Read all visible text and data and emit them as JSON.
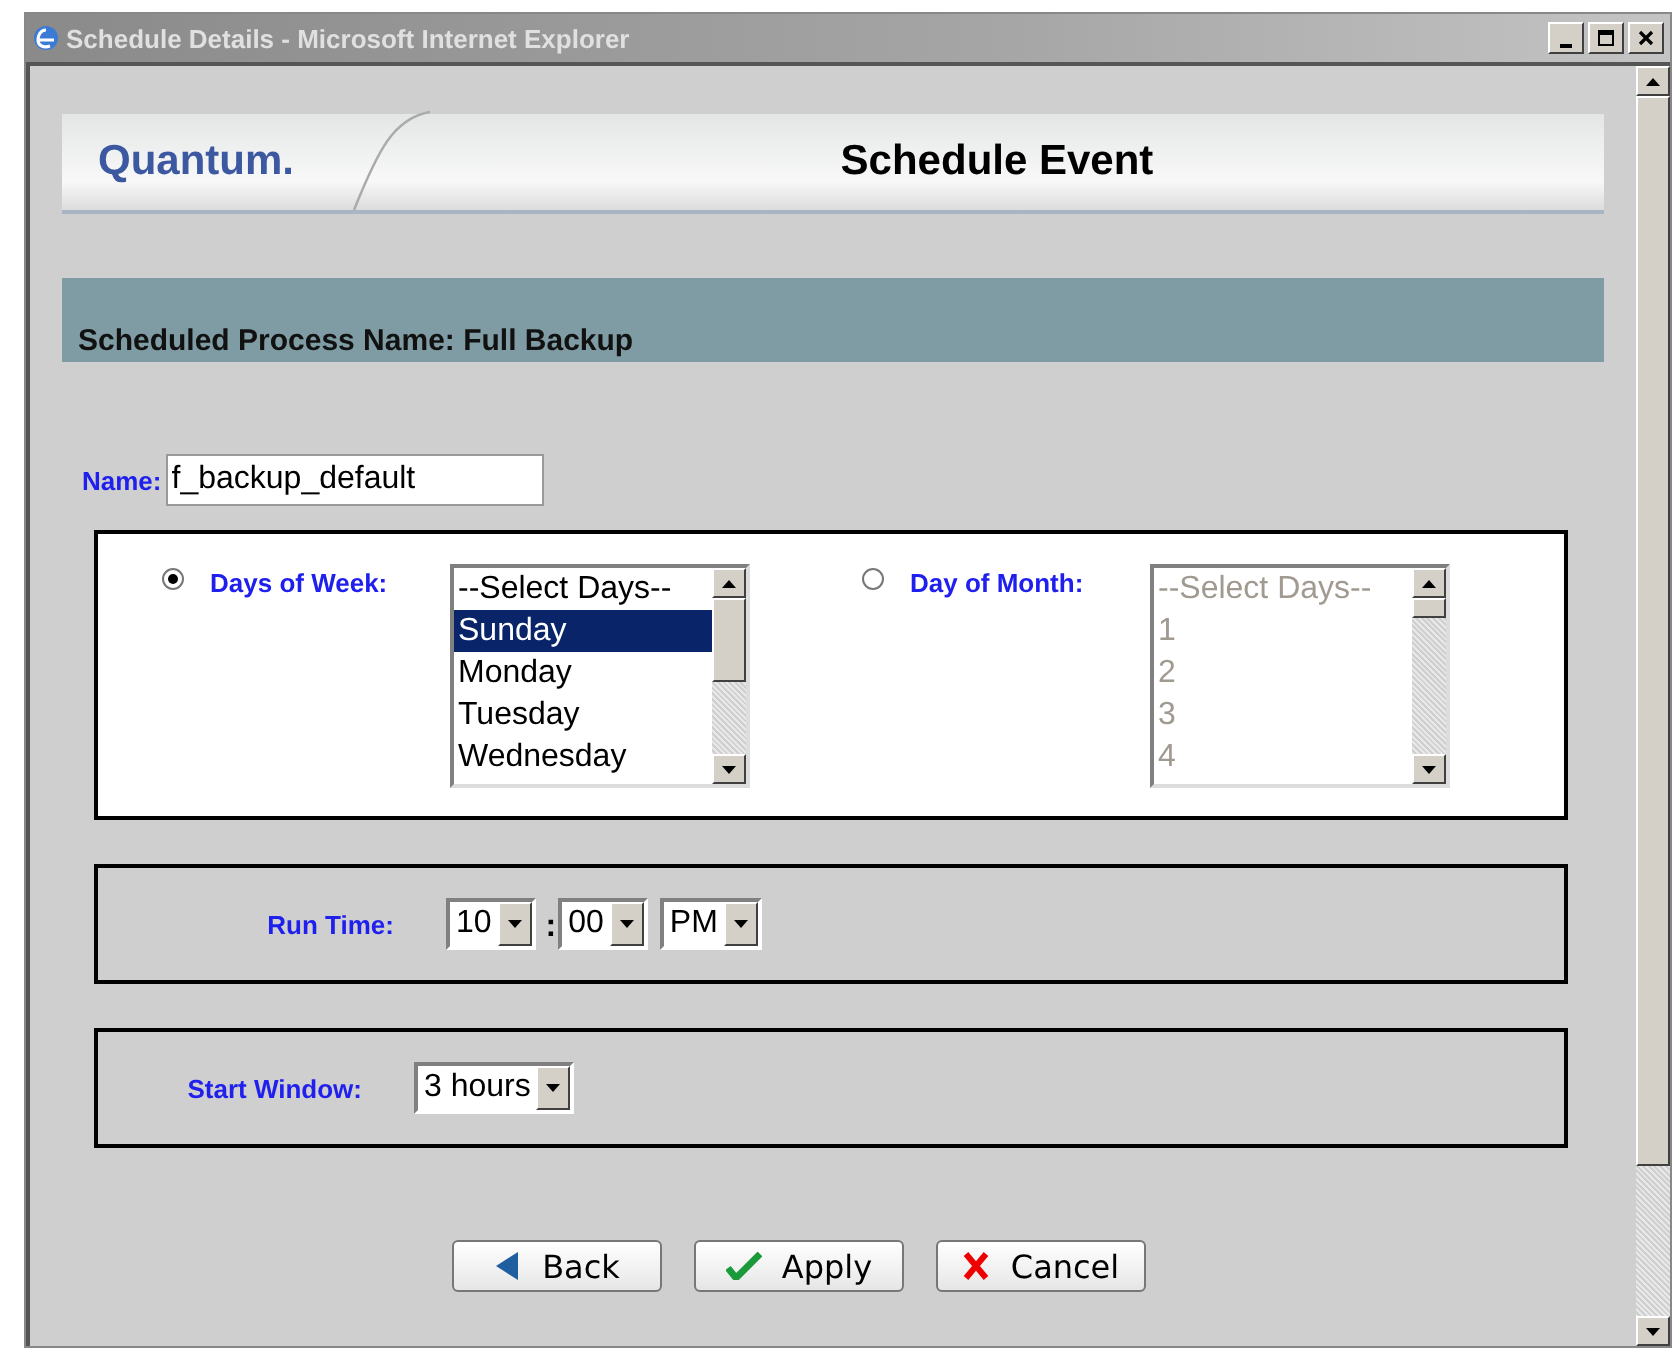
{
  "window": {
    "title": "Schedule Details - Microsoft Internet Explorer"
  },
  "header": {
    "logo": "Quantum.",
    "title": "Schedule Event"
  },
  "process_heading": "Scheduled Process Name: Full Backup",
  "name_field": {
    "label": "Name:",
    "value": "f_backup_default"
  },
  "day_options": [
    {
      "label": "Days of Week:",
      "selected": true,
      "list": {
        "disabled": false,
        "items": [
          {
            "text": "--Select Days--",
            "selected": false
          },
          {
            "text": "Sunday",
            "selected": true
          },
          {
            "text": "Monday",
            "selected": false
          },
          {
            "text": "Tuesday",
            "selected": false
          },
          {
            "text": "Wednesday",
            "selected": false
          }
        ]
      }
    },
    {
      "label": "Day of Month:",
      "selected": false,
      "list": {
        "disabled": true,
        "items": [
          {
            "text": "--Select Days--",
            "selected": false
          },
          {
            "text": "1",
            "selected": false
          },
          {
            "text": "2",
            "selected": false
          },
          {
            "text": "3",
            "selected": false
          },
          {
            "text": "4",
            "selected": false
          }
        ]
      }
    }
  ],
  "run_time": {
    "label": "Run Time:",
    "hour": "10",
    "separator": ":",
    "minute": "00",
    "period": "PM"
  },
  "start_window": {
    "label": "Start Window:",
    "value": "3 hours"
  },
  "buttons": [
    {
      "kind": "back",
      "label": "Back"
    },
    {
      "kind": "apply",
      "label": "Apply"
    },
    {
      "kind": "cancel",
      "label": "Cancel"
    }
  ]
}
